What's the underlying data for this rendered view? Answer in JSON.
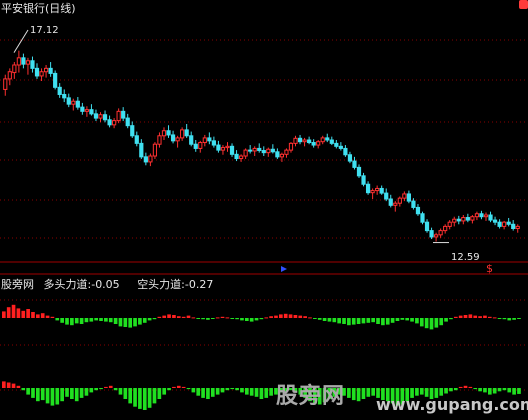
{
  "window": {
    "title": "平安银行(日线)"
  },
  "indicator": {
    "name": "股旁网",
    "long_label": "多头力道:",
    "long_value": "-0.05",
    "short_label": "空头力道:",
    "short_value": "-0.27"
  },
  "watermark": {
    "text": "股旁网",
    "url": "www.gupang.com"
  },
  "colors": {
    "up": "#ff3030",
    "down": "#40e0f0",
    "pos_bar": "#ff2020",
    "neg_bar": "#20e020",
    "grid": "#8a0000",
    "axis": "#a00000"
  },
  "chart_data": [
    {
      "type": "candlestick",
      "title": "平安银行(日线)",
      "high_label": "17.12",
      "low_label": "12.59",
      "ylim": [
        12.2,
        17.8
      ],
      "candles": [
        [
          16.2,
          16.55,
          16.05,
          16.45
        ],
        [
          16.45,
          16.7,
          16.3,
          16.62
        ],
        [
          16.6,
          16.85,
          16.45,
          16.78
        ],
        [
          16.78,
          17.12,
          16.6,
          16.95
        ],
        [
          16.95,
          17.05,
          16.7,
          16.8
        ],
        [
          16.8,
          16.95,
          16.55,
          16.88
        ],
        [
          16.88,
          16.98,
          16.6,
          16.7
        ],
        [
          16.7,
          16.82,
          16.45,
          16.52
        ],
        [
          16.52,
          16.7,
          16.4,
          16.62
        ],
        [
          16.62,
          16.78,
          16.48,
          16.7
        ],
        [
          16.7,
          16.85,
          16.5,
          16.58
        ],
        [
          16.58,
          16.65,
          16.2,
          16.25
        ],
        [
          16.25,
          16.35,
          16.0,
          16.08
        ],
        [
          16.08,
          16.2,
          15.9,
          16.0
        ],
        [
          16.0,
          16.1,
          15.78,
          15.85
        ],
        [
          15.85,
          15.98,
          15.7,
          15.92
        ],
        [
          15.92,
          16.02,
          15.72,
          15.78
        ],
        [
          15.78,
          15.88,
          15.6,
          15.68
        ],
        [
          15.68,
          15.8,
          15.55,
          15.72
        ],
        [
          15.72,
          15.85,
          15.58,
          15.62
        ],
        [
          15.62,
          15.72,
          15.45,
          15.52
        ],
        [
          15.52,
          15.66,
          15.42,
          15.6
        ],
        [
          15.6,
          15.7,
          15.42,
          15.48
        ],
        [
          15.48,
          15.58,
          15.3,
          15.36
        ],
        [
          15.36,
          15.52,
          15.28,
          15.46
        ],
        [
          15.46,
          15.75,
          15.4,
          15.68
        ],
        [
          15.68,
          15.78,
          15.45,
          15.52
        ],
        [
          15.52,
          15.62,
          15.28,
          15.34
        ],
        [
          15.34,
          15.44,
          15.05,
          15.1
        ],
        [
          15.1,
          15.2,
          14.85,
          14.92
        ],
        [
          14.92,
          15.02,
          14.55,
          14.6
        ],
        [
          14.6,
          14.7,
          14.4,
          14.48
        ],
        [
          14.48,
          14.68,
          14.38,
          14.62
        ],
        [
          14.62,
          14.95,
          14.55,
          14.9
        ],
        [
          14.9,
          15.18,
          14.82,
          15.1
        ],
        [
          15.1,
          15.3,
          15.0,
          15.22
        ],
        [
          15.22,
          15.35,
          15.05,
          15.12
        ],
        [
          15.12,
          15.22,
          14.92,
          14.98
        ],
        [
          14.98,
          15.1,
          14.82,
          15.05
        ],
        [
          15.05,
          15.3,
          14.98,
          15.24
        ],
        [
          15.24,
          15.38,
          15.05,
          15.1
        ],
        [
          15.1,
          15.2,
          14.85,
          14.9
        ],
        [
          14.9,
          15.0,
          14.72,
          14.8
        ],
        [
          14.8,
          14.98,
          14.7,
          14.94
        ],
        [
          14.94,
          15.12,
          14.85,
          15.05
        ],
        [
          15.05,
          15.18,
          14.9,
          14.98
        ],
        [
          14.98,
          15.08,
          14.82,
          14.88
        ],
        [
          14.88,
          14.98,
          14.7,
          14.76
        ],
        [
          14.76,
          14.88,
          14.65,
          14.82
        ],
        [
          14.82,
          14.95,
          14.72,
          14.85
        ],
        [
          14.85,
          14.92,
          14.6,
          14.66
        ],
        [
          14.66,
          14.76,
          14.5,
          14.56
        ],
        [
          14.56,
          14.66,
          14.48,
          14.62
        ],
        [
          14.62,
          14.8,
          14.55,
          14.76
        ],
        [
          14.76,
          14.88,
          14.68,
          14.74
        ],
        [
          14.74,
          14.85,
          14.62,
          14.8
        ],
        [
          14.8,
          14.92,
          14.7,
          14.75
        ],
        [
          14.75,
          14.85,
          14.62,
          14.7
        ],
        [
          14.7,
          14.82,
          14.6,
          14.78
        ],
        [
          14.78,
          14.9,
          14.68,
          14.72
        ],
        [
          14.72,
          14.8,
          14.55,
          14.6
        ],
        [
          14.6,
          14.7,
          14.48,
          14.66
        ],
        [
          14.66,
          14.8,
          14.58,
          14.76
        ],
        [
          14.76,
          14.95,
          14.7,
          14.92
        ],
        [
          14.92,
          15.1,
          14.85,
          15.04
        ],
        [
          15.04,
          15.12,
          14.9,
          14.96
        ],
        [
          14.96,
          15.05,
          14.85,
          15.0
        ],
        [
          15.0,
          15.08,
          14.9,
          14.94
        ],
        [
          14.94,
          15.02,
          14.82,
          14.88
        ],
        [
          14.88,
          15.0,
          14.8,
          14.96
        ],
        [
          14.96,
          15.1,
          14.9,
          15.05
        ],
        [
          15.05,
          15.15,
          14.95,
          15.0
        ],
        [
          15.0,
          15.08,
          14.88,
          14.92
        ],
        [
          14.92,
          15.0,
          14.8,
          14.85
        ],
        [
          14.85,
          14.95,
          14.75,
          14.8
        ],
        [
          14.8,
          14.88,
          14.6,
          14.65
        ],
        [
          14.65,
          14.72,
          14.45,
          14.5
        ],
        [
          14.5,
          14.6,
          14.3,
          14.35
        ],
        [
          14.35,
          14.42,
          14.1,
          14.15
        ],
        [
          14.15,
          14.22,
          13.9,
          13.95
        ],
        [
          13.95,
          14.02,
          13.7,
          13.75
        ],
        [
          13.75,
          13.85,
          13.6,
          13.8
        ],
        [
          13.8,
          13.92,
          13.7,
          13.85
        ],
        [
          13.85,
          13.92,
          13.7,
          13.74
        ],
        [
          13.74,
          13.85,
          13.55,
          13.6
        ],
        [
          13.6,
          13.7,
          13.4,
          13.45
        ],
        [
          13.45,
          13.55,
          13.3,
          13.5
        ],
        [
          13.5,
          13.66,
          13.42,
          13.62
        ],
        [
          13.62,
          13.78,
          13.55,
          13.72
        ],
        [
          13.72,
          13.8,
          13.5,
          13.55
        ],
        [
          13.55,
          13.62,
          13.35,
          13.4
        ],
        [
          13.4,
          13.48,
          13.2,
          13.25
        ],
        [
          13.25,
          13.3,
          13.0,
          13.05
        ],
        [
          13.05,
          13.12,
          12.8,
          12.85
        ],
        [
          12.85,
          12.92,
          12.65,
          12.7
        ],
        [
          12.7,
          12.8,
          12.59,
          12.75
        ],
        [
          12.75,
          12.9,
          12.68,
          12.85
        ],
        [
          12.85,
          13.0,
          12.78,
          12.95
        ],
        [
          12.95,
          13.1,
          12.88,
          13.05
        ],
        [
          13.05,
          13.18,
          12.95,
          13.12
        ],
        [
          13.12,
          13.2,
          13.0,
          13.08
        ],
        [
          13.08,
          13.22,
          13.0,
          13.16
        ],
        [
          13.16,
          13.25,
          13.05,
          13.1
        ],
        [
          13.1,
          13.22,
          13.02,
          13.18
        ],
        [
          13.18,
          13.3,
          13.1,
          13.25
        ],
        [
          13.25,
          13.32,
          13.12,
          13.18
        ],
        [
          13.18,
          13.28,
          13.08,
          13.22
        ],
        [
          13.22,
          13.3,
          13.05,
          13.1
        ],
        [
          13.1,
          13.18,
          12.98,
          13.05
        ],
        [
          13.05,
          13.12,
          12.9,
          12.95
        ],
        [
          12.95,
          13.08,
          12.88,
          13.05
        ],
        [
          13.05,
          13.15,
          12.95,
          13.0
        ],
        [
          13.0,
          13.1,
          12.85,
          12.9
        ],
        [
          12.9,
          13.0,
          12.8,
          12.95
        ]
      ]
    },
    {
      "type": "bar",
      "title": "股旁网 多头力道/空头力道",
      "series": [
        {
          "name": "多头力道",
          "values": [
            0.55,
            0.9,
            1.1,
            0.8,
            0.6,
            0.75,
            0.5,
            0.3,
            0.4,
            0.2,
            0.1,
            -0.2,
            -0.4,
            -0.55,
            -0.6,
            -0.45,
            -0.5,
            -0.35,
            -0.3,
            -0.2,
            -0.25,
            -0.3,
            -0.35,
            -0.5,
            -0.7,
            -0.75,
            -0.8,
            -0.7,
            -0.55,
            -0.4,
            -0.2,
            -0.1,
            0.1,
            0.2,
            0.3,
            0.25,
            0.15,
            0.1,
            0.2,
            0.05,
            -0.05,
            -0.1,
            -0.15,
            -0.05,
            0.05,
            0.1,
            0.05,
            -0.05,
            -0.1,
            -0.2,
            -0.25,
            -0.3,
            -0.2,
            -0.1,
            0.05,
            0.15,
            0.2,
            0.3,
            0.35,
            0.3,
            0.25,
            0.2,
            0.15,
            0.05,
            -0.05,
            -0.15,
            -0.25,
            -0.3,
            -0.35,
            -0.45,
            -0.5,
            -0.6,
            -0.55,
            -0.5,
            -0.45,
            -0.4,
            -0.35,
            -0.5,
            -0.6,
            -0.55,
            -0.4,
            -0.25,
            -0.15,
            -0.2,
            -0.3,
            -0.45,
            -0.7,
            -0.85,
            -0.95,
            -0.8,
            -0.6,
            -0.3,
            -0.1,
            0.1,
            0.2,
            0.25,
            0.3,
            0.2,
            0.15,
            0.2,
            0.1,
            0.05,
            -0.05,
            -0.1,
            -0.2,
            -0.15,
            -0.05
          ]
        },
        {
          "name": "空头力道",
          "values": [
            0.3,
            0.25,
            0.2,
            0.1,
            -0.1,
            -0.3,
            -0.45,
            -0.6,
            -0.55,
            -0.7,
            -0.8,
            -0.75,
            -0.6,
            -0.4,
            -0.5,
            -0.6,
            -0.45,
            -0.35,
            -0.2,
            -0.1,
            -0.05,
            0.05,
            0.1,
            -0.1,
            -0.3,
            -0.5,
            -0.7,
            -0.85,
            -0.95,
            -1.0,
            -0.9,
            -0.7,
            -0.5,
            -0.3,
            -0.1,
            0.05,
            0.1,
            0.05,
            -0.05,
            -0.2,
            -0.35,
            -0.45,
            -0.5,
            -0.4,
            -0.3,
            -0.2,
            -0.1,
            -0.05,
            -0.1,
            -0.2,
            -0.3,
            -0.35,
            -0.4,
            -0.5,
            -0.45,
            -0.35,
            -0.3,
            -0.2,
            -0.15,
            -0.1,
            -0.2,
            -0.3,
            -0.45,
            -0.6,
            -0.7,
            -0.75,
            -0.65,
            -0.5,
            -0.4,
            -0.3,
            -0.35,
            -0.45,
            -0.55,
            -0.6,
            -0.5,
            -0.4,
            -0.35,
            -0.45,
            -0.55,
            -0.6,
            -0.7,
            -0.8,
            -0.75,
            -0.6,
            -0.45,
            -0.35,
            -0.3,
            -0.4,
            -0.5,
            -0.45,
            -0.35,
            -0.25,
            -0.15,
            -0.1,
            0.05,
            0.1,
            0.05,
            -0.05,
            -0.15,
            -0.2,
            -0.3,
            -0.25,
            -0.15,
            -0.1,
            -0.2,
            -0.3,
            -0.27
          ]
        }
      ]
    }
  ]
}
